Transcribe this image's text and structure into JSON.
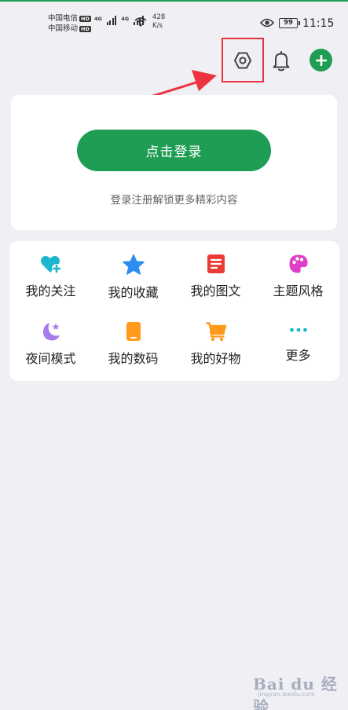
{
  "status_bar": {
    "carrier1": "中国电信",
    "carrier2": "中国移动",
    "hd_badge": "HD",
    "network1": "4G",
    "network2": "4G",
    "speed_value": "428",
    "speed_unit": "K/s",
    "battery": "99",
    "time": "11:15"
  },
  "header": {
    "settings_icon": "hexagon-settings-icon",
    "notification_icon": "bell-icon",
    "add_icon": "plus-icon",
    "accent_color": "#1f9d55",
    "highlight_color": "#e8333c"
  },
  "login": {
    "button_label": "点击登录",
    "subtitle": "登录注册解锁更多精彩内容"
  },
  "grid": {
    "items": [
      {
        "label": "我的关注",
        "icon": "heart-plus-icon",
        "color": "#1cb6cf"
      },
      {
        "label": "我的收藏",
        "icon": "star-icon",
        "color": "#2d8cf0"
      },
      {
        "label": "我的图文",
        "icon": "document-icon",
        "color": "#ea3b36"
      },
      {
        "label": "主题风格",
        "icon": "palette-icon",
        "color": "#e040c8"
      },
      {
        "label": "夜间模式",
        "icon": "moon-icon",
        "color": "#a67bec"
      },
      {
        "label": "我的数码",
        "icon": "phone-icon",
        "color": "#ff9a1a"
      },
      {
        "label": "我的好物",
        "icon": "cart-icon",
        "color": "#ff9a1a"
      },
      {
        "label": "更多",
        "icon": "more-dots-icon",
        "color": "#22b5d3"
      }
    ]
  },
  "watermark": {
    "brand": "Bai du 经验",
    "url": "jingyan.baidu.com"
  }
}
